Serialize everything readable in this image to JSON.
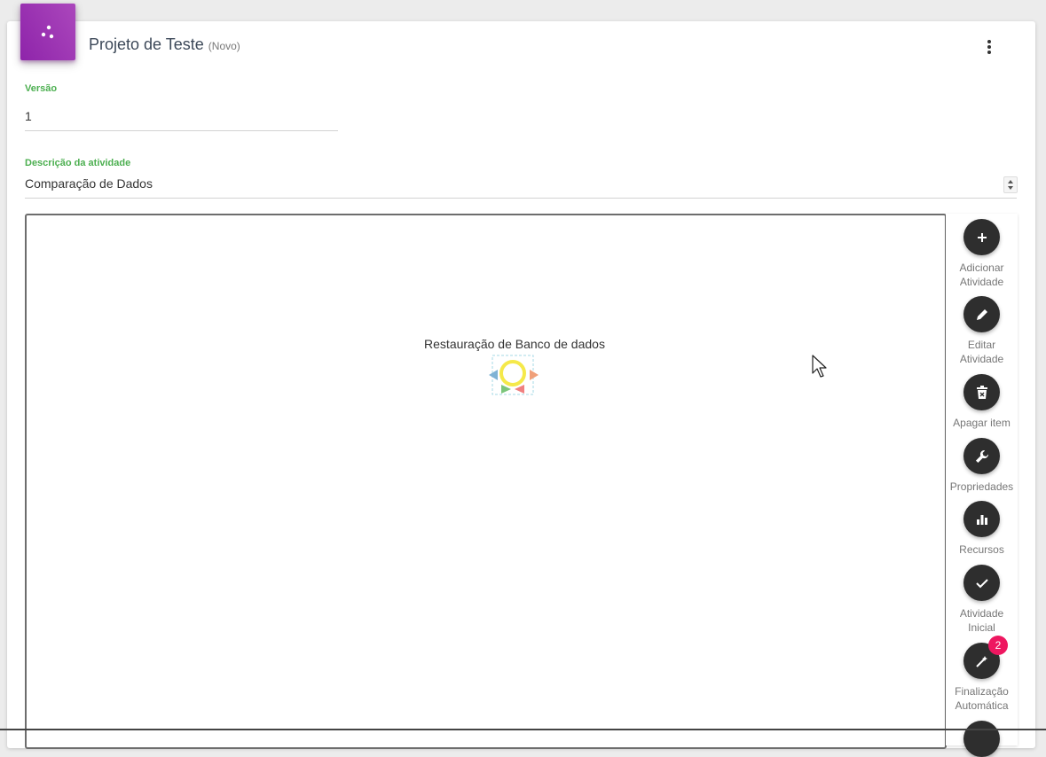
{
  "header": {
    "title": "Projeto de Teste",
    "status": "(Novo)",
    "app_icon": "scatter-dots-icon",
    "more_icon": "more-vert-icon",
    "accent_color": "#9c27b0"
  },
  "form": {
    "version_label": "Versão",
    "version_value": "1",
    "description_label": "Descrição da atividade",
    "description_value": "Comparação de Dados",
    "label_color": "#4caf50"
  },
  "canvas": {
    "node_label": "Restauração de Banco de dados"
  },
  "toolbar": {
    "items": [
      {
        "label_line1": "Adicionar",
        "label_line2": "Atividade",
        "icon": "plus-icon"
      },
      {
        "label_line1": "Editar",
        "label_line2": "Atividade",
        "icon": "pencil-icon"
      },
      {
        "label_line1": "Apagar item",
        "label_line2": "",
        "icon": "trash-icon"
      },
      {
        "label_line1": "Propriedades",
        "label_line2": "",
        "icon": "wrench-icon"
      },
      {
        "label_line1": "Recursos",
        "label_line2": "",
        "icon": "bar-chart-icon"
      },
      {
        "label_line1": "Atividade",
        "label_line2": "Inicial",
        "icon": "check-icon"
      },
      {
        "label_line1": "Finalização",
        "label_line2": "Automática",
        "icon": "wand-icon",
        "badge": "2"
      }
    ],
    "button_color": "#2e2e2e",
    "badge_color": "#ee1760"
  }
}
